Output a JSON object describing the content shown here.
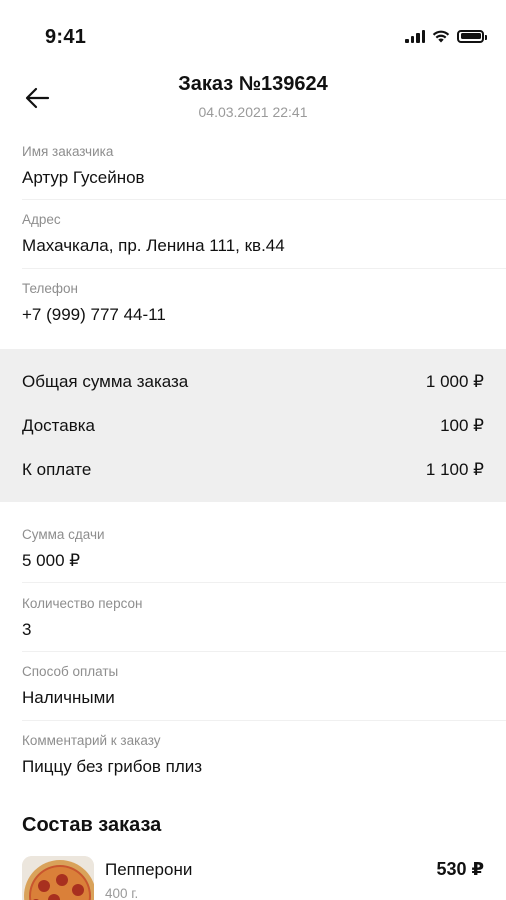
{
  "status_bar": {
    "time": "9:41"
  },
  "header": {
    "title": "Заказ №139624",
    "date": "04.03.2021 22:41"
  },
  "customer": {
    "name_label": "Имя заказчика",
    "name": "Артур Гусейнов",
    "address_label": "Адрес",
    "address": "Махачкала, пр. Ленина 111, кв.44",
    "phone_label": "Телефон",
    "phone": "+7 (999) 777 44-11"
  },
  "totals": [
    {
      "label": "Общая сумма заказа",
      "value": "1 000 ₽"
    },
    {
      "label": "Доставка",
      "value": "100 ₽"
    },
    {
      "label": "К оплате",
      "value": "1 100 ₽"
    }
  ],
  "details": {
    "change_label": "Сумма сдачи",
    "change": "5 000 ₽",
    "persons_label": "Количество персон",
    "persons": "3",
    "payment_label": "Способ оплаты",
    "payment": "Наличными",
    "comment_label": "Комментарий к заказу",
    "comment": "Пиццу без грибов плиз"
  },
  "order": {
    "section_title": "Состав заказа",
    "items": [
      {
        "name": "Пепперони",
        "weight": "400 г.",
        "price": "530 ₽"
      }
    ]
  },
  "icons": {
    "back": "arrow-left-icon",
    "signal": "cellular-signal-icon",
    "wifi": "wifi-icon",
    "battery": "battery-icon",
    "item_image": "pizza-pepperoni-image"
  }
}
